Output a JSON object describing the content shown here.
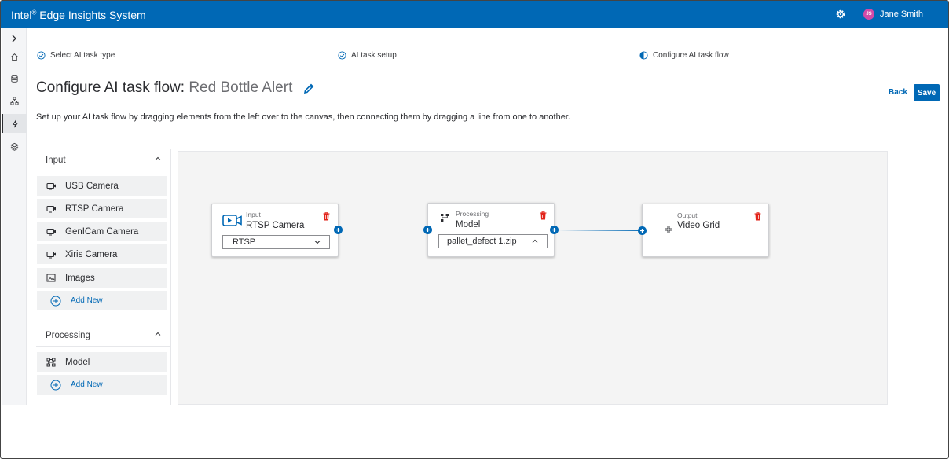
{
  "header": {
    "brand_prefix": "Intel",
    "brand_mark": "®",
    "brand_rest": " Edge Insights System",
    "user_initials": "JS",
    "user_name": "Jane Smith"
  },
  "sidebar": {
    "icons": [
      "expand-chevron",
      "home-icon",
      "database-icon",
      "hierarchy-icon",
      "lightning-icon",
      "layers-icon"
    ]
  },
  "steps": [
    {
      "label": "Select AI task type",
      "state": "done"
    },
    {
      "label": "AI task setup",
      "state": "done"
    },
    {
      "label": "Configure AI task flow",
      "state": "current"
    }
  ],
  "page": {
    "title_prefix": "Configure AI task flow: ",
    "task_name": "Red Bottle Alert",
    "back_label": "Back",
    "save_label": "Save",
    "description": "Set up your AI task flow by dragging elements from the left over to the canvas, then connecting them by dragging a line from one to another."
  },
  "palette": {
    "input": {
      "title": "Input",
      "items": [
        "USB Camera",
        "RTSP Camera",
        "GenICam Camera",
        "Xiris Camera",
        "Images"
      ],
      "add_label": "Add New"
    },
    "processing": {
      "title": "Processing",
      "items": [
        "Model"
      ],
      "add_label": "Add New"
    }
  },
  "canvas": {
    "nodes": {
      "input": {
        "type_label": "Input",
        "name": "RTSP Camera",
        "select_value": "RTSP"
      },
      "processing": {
        "type_label": "Processing",
        "name": "Model",
        "select_value": "pallet_defect 1.zip"
      },
      "output": {
        "type_label": "Output",
        "name": "Video Grid"
      }
    }
  },
  "colors": {
    "brand": "#0068b5",
    "delete": "#e2231a",
    "avatar": "#d24aa8"
  }
}
